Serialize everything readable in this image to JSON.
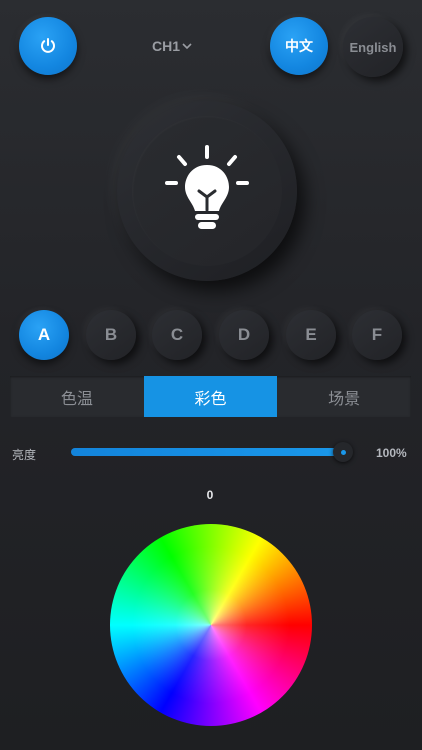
{
  "header": {
    "channel_label": "CH1",
    "lang_cn_label": "中文",
    "lang_en_label": "English"
  },
  "icons": {
    "power": "power-icon",
    "channel_dropdown": "chevron-down-icon",
    "bulb": "lightbulb-icon"
  },
  "groups": [
    {
      "label": "A",
      "selected": true
    },
    {
      "label": "B",
      "selected": false
    },
    {
      "label": "C",
      "selected": false
    },
    {
      "label": "D",
      "selected": false
    },
    {
      "label": "E",
      "selected": false
    },
    {
      "label": "F",
      "selected": false
    }
  ],
  "tabs": [
    {
      "label": "色温",
      "active": false
    },
    {
      "label": "彩色",
      "active": true
    },
    {
      "label": "场景",
      "active": false
    }
  ],
  "brightness": {
    "label": "亮度",
    "value_text": "100%",
    "level": 1.0
  },
  "hue": {
    "value_text": "0"
  },
  "colors": {
    "accent": "#1693e4",
    "background": "#232428"
  }
}
